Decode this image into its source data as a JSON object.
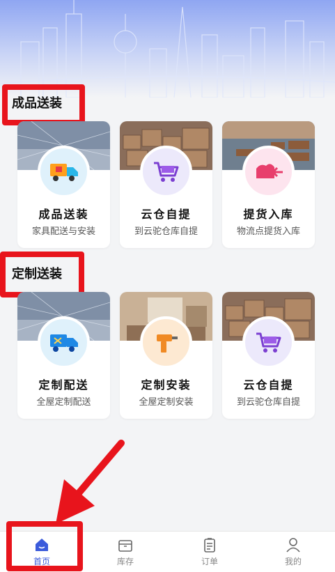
{
  "sections": [
    {
      "title": "成品送装",
      "cards": [
        {
          "title": "成品送装",
          "subtitle": "家具配送与安装",
          "icon": "truck-icon"
        },
        {
          "title": "云仓自提",
          "subtitle": "到云驼仓库自提",
          "icon": "cart-icon"
        },
        {
          "title": "提货入库",
          "subtitle": "物流点提货入库",
          "icon": "inbound-icon"
        }
      ]
    },
    {
      "title": "定制送装",
      "cards": [
        {
          "title": "定制配送",
          "subtitle": "全屋定制配送",
          "icon": "delivery-truck-icon"
        },
        {
          "title": "定制安装",
          "subtitle": "全屋定制安装",
          "icon": "drill-icon"
        },
        {
          "title": "云仓自提",
          "subtitle": "到云驼仓库自提",
          "icon": "cart-icon"
        }
      ]
    }
  ],
  "tabbar": [
    {
      "label": "首页",
      "icon": "home-icon",
      "active": true
    },
    {
      "label": "库存",
      "icon": "box-icon",
      "active": false
    },
    {
      "label": "订单",
      "icon": "clipboard-icon",
      "active": false
    },
    {
      "label": "我的",
      "icon": "user-icon",
      "active": false
    }
  ],
  "colors": {
    "accent": "#3b5bdb",
    "highlight": "#e8141c"
  }
}
